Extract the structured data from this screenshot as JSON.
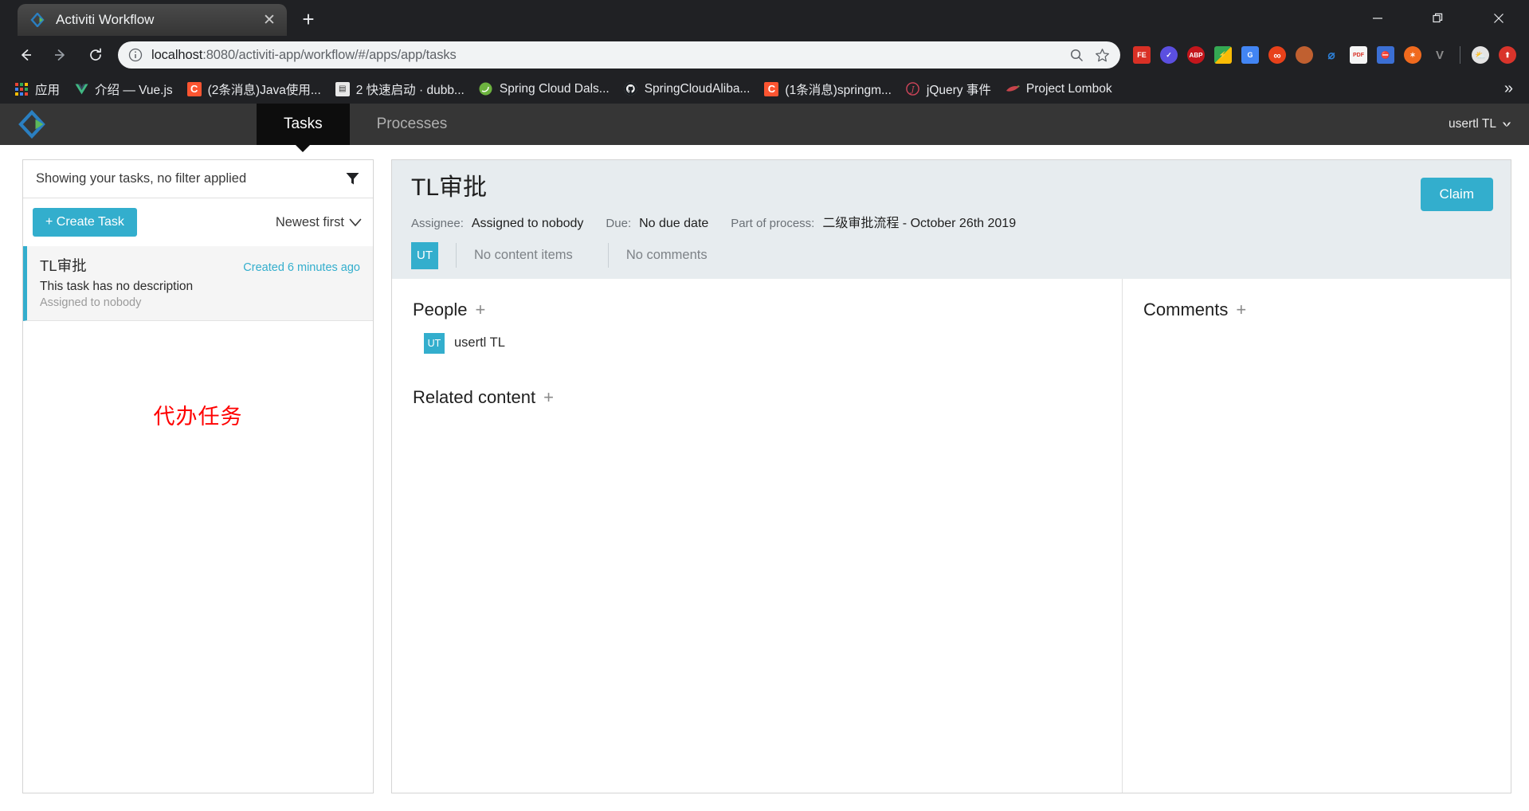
{
  "browser": {
    "tab": {
      "title": "Activiti Workflow",
      "favicon": "activiti-diamond-icon",
      "close": "✕"
    },
    "new_tab_label": "+",
    "window_controls": {
      "minimize": "—",
      "maximize": "❐",
      "close": "✕"
    },
    "nav": {
      "back": "←",
      "forward": "→",
      "reload": "⟳"
    },
    "omnibox": {
      "info_icon": "site-info-icon",
      "url_host": "localhost",
      "url_rest": ":8080/activiti-app/workflow/#/apps/app/tasks",
      "zoom_icon": "search-icon",
      "bookmark_icon": "star-icon"
    },
    "extensions": [
      {
        "name": "foxit-extension",
        "label": "FE",
        "color": "#d93025"
      },
      {
        "name": "check-circle-extension",
        "label": "✓",
        "color": "#5b4fe0"
      },
      {
        "name": "adblock-plus-extension",
        "label": "ABP",
        "color": "#c4161c"
      },
      {
        "name": "lightshot-extension",
        "label": "⚡",
        "color": "#34a853"
      },
      {
        "name": "google-translate-extension",
        "label": "G",
        "color": "#4285f4"
      },
      {
        "name": "infinity-extension",
        "label": "∞",
        "color": "#e8411a"
      },
      {
        "name": "monkey-extension",
        "label": "🐵",
        "color": "#c06030"
      },
      {
        "name": "evernote-extension",
        "label": "⌀",
        "color": "#2c7fd6"
      },
      {
        "name": "pdfjs-extension",
        "label": "PDF",
        "color": "#d93025"
      },
      {
        "name": "block-extension",
        "label": "⛔",
        "color": "#3b6fd4"
      },
      {
        "name": "orange-extension",
        "label": "✶",
        "color": "#f06a1e"
      },
      {
        "name": "vue-devtools-extension",
        "label": "V",
        "color": "#8c8c8c"
      },
      {
        "name": "profile-avatar",
        "label": "⛅",
        "color": "#d8d8d8"
      },
      {
        "name": "upload-extension",
        "label": "⬆",
        "color": "#d9342b"
      }
    ],
    "bookmarks": [
      {
        "label": "应用",
        "icon": "apps-grid-icon",
        "icon_text": "⋮⋮",
        "color": "#4285f4"
      },
      {
        "label": "介绍 — Vue.js",
        "icon": "vue-icon",
        "icon_text": "V",
        "color": "#41b883"
      },
      {
        "label": "(2条消息)Java使用...",
        "icon": "csdn-icon",
        "icon_text": "C",
        "color": "#fc5531"
      },
      {
        "label": "2 快速启动 · dubb...",
        "icon": "book-icon",
        "icon_text": "☷",
        "color": "#dedede"
      },
      {
        "label": "Spring Cloud Dals...",
        "icon": "spring-icon",
        "icon_text": "❦",
        "color": "#6db33f"
      },
      {
        "label": "SpringCloudAliba...",
        "icon": "github-icon",
        "icon_text": "●",
        "color": "#24292e"
      },
      {
        "label": "(1条消息)springm...",
        "icon": "csdn-icon",
        "icon_text": "C",
        "color": "#fc5531"
      },
      {
        "label": "jQuery 事件",
        "icon": "jquery-icon",
        "icon_text": "𝐽",
        "color": "#d0455a"
      },
      {
        "label": "Project Lombok",
        "icon": "lombok-icon",
        "icon_text": "➜",
        "color": "#c8444b"
      }
    ],
    "bookmarks_overflow": "»"
  },
  "app": {
    "logo_name": "activiti-logo",
    "tabs": [
      {
        "label": "Tasks",
        "active": true
      },
      {
        "label": "Processes",
        "active": false
      }
    ],
    "user_menu": {
      "name": "usertl TL",
      "chevron": "♥"
    }
  },
  "left_panel": {
    "filter_text": "Showing your tasks, no filter applied",
    "filter_icon": "funnel-icon",
    "create_task_label": "+ Create Task",
    "sort_label": "Newest first",
    "sort_chevron": "⌄",
    "tasks": [
      {
        "name": "TL审批",
        "created": "Created 6 minutes ago",
        "description": "This task has no description",
        "assignee": "Assigned to nobody"
      }
    ],
    "annotation": "代办任务"
  },
  "detail": {
    "title": "TL审批",
    "assignee_label": "Assignee:",
    "assignee_value": "Assigned to nobody",
    "due_label": "Due:",
    "due_value": "No due date",
    "process_label": "Part of process:",
    "process_value": "二级审批流程 - October 26th 2019",
    "claim_label": "Claim",
    "avatar_initials": "UT",
    "content_items": "No content items",
    "comments_summary": "No comments",
    "people": {
      "title": "People",
      "add": "+",
      "members": [
        {
          "initials": "UT",
          "name": "usertl TL"
        }
      ]
    },
    "related_content": {
      "title": "Related content",
      "add": "+"
    },
    "comments": {
      "title": "Comments",
      "add": "+"
    }
  }
}
